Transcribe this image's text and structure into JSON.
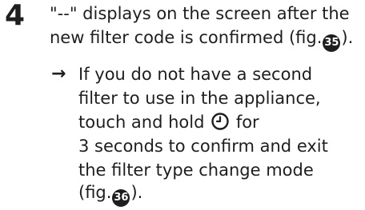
{
  "step": {
    "number": "4",
    "line1": "\"--\" displays on the screen after the",
    "line2_pre": "new filter code is confirmed (fig.",
    "fig1": "35",
    "line2_post": ")."
  },
  "substep": {
    "arrow": "→",
    "line1": "If you do not have a second",
    "line2": "filter to use in the appliance,",
    "line3_pre": "touch and hold",
    "line3_post": "for",
    "line4": "3 seconds to confirm and exit",
    "line5": "the filter type change mode",
    "line6_pre": "(fig.",
    "fig2": "36",
    "line6_post": ")."
  },
  "icons": {
    "timer": "timer-icon"
  }
}
